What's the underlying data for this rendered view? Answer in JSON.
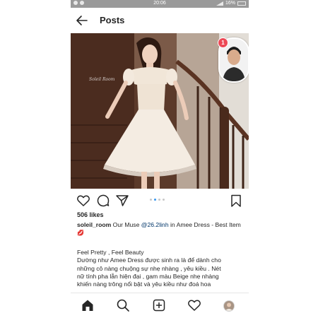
{
  "status_bar": {
    "time": "20:06",
    "battery": "16%"
  },
  "header": {
    "title": "Posts"
  },
  "post": {
    "image_watermark": "Soleil Room",
    "story_badge_count": "1",
    "carousel_position": {
      "current": 2,
      "total": 4
    },
    "likes": "506 likes",
    "caption": {
      "username": "soleil_room",
      "text_before_mention": "Our Muse",
      "mention": "@26.2linh",
      "text_after_mention": "in Amee Dress - Best Item",
      "emoji": "💋"
    },
    "body": {
      "heading": "Feel Pretty , Feel Beauty",
      "line1": "Dường như Amee Dress được sinh ra là để dành cho",
      "line2": "những cô nàng chuộng sự nhẹ nhàng , yêu kiều . Nét",
      "line3": "nữ tính pha lẫn hiện đại , gam màu Beige nhẹ nhàng",
      "line4": "khiến nàng trông nổi bật và yêu kiều như đoá hoa"
    }
  },
  "icons": {
    "back": "arrow-left",
    "like": "heart-outline",
    "comment": "speech-bubble",
    "share": "paper-plane",
    "save": "bookmark",
    "home": "home-filled",
    "search": "magnifier",
    "new_post": "plus-square",
    "activity": "heart-outline",
    "profile": "avatar"
  },
  "colors": {
    "mention": "#003569",
    "carousel_active": "#3897f0",
    "badge": "#ed4956"
  }
}
